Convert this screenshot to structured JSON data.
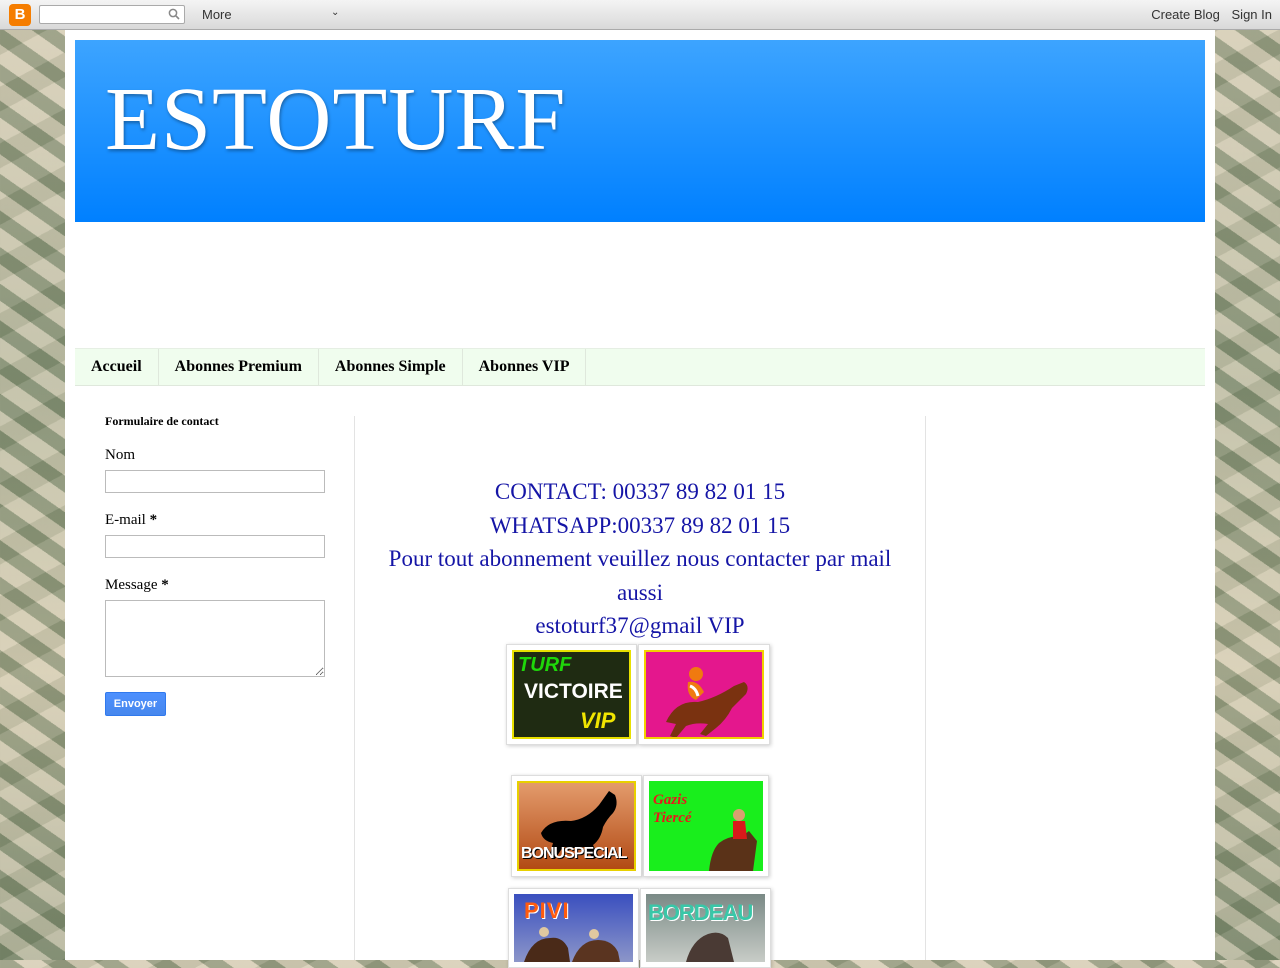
{
  "navbar": {
    "more_label": "More",
    "create_blog_label": "Create Blog",
    "sign_in_label": "Sign In"
  },
  "header": {
    "title": "ESTOTURF"
  },
  "tabs": [
    {
      "label": "Accueil"
    },
    {
      "label": "Abonnes Premium"
    },
    {
      "label": "Abonnes Simple"
    },
    {
      "label": "Abonnes VIP"
    }
  ],
  "contact_form": {
    "title": "Formulaire de contact",
    "name_label": "Nom",
    "email_label": "E-mail",
    "message_label": "Message",
    "required_mark": "*",
    "submit_label": "Envoyer"
  },
  "main": {
    "lines": [
      "CONTACT: 00337 89 82 01 15",
      "WHATSAPP:00337 89 82 01 15",
      "Pour tout abonnement veuillez nous contacter par mail aussi",
      "estoturf37@gmail VIP"
    ],
    "banners": {
      "turf_victoire": {
        "line1": "TURF",
        "line2": "VICTOIRE",
        "line3": "VIP"
      },
      "bonuspecial": {
        "text": "BONUSPECIAL"
      },
      "gazette": {
        "line1": "Gazis",
        "line2": "Tiercé"
      },
      "pivi": {
        "text": "PIVI"
      },
      "bordeau": {
        "text": "BORDEAU"
      }
    }
  },
  "colors": {
    "header_blue": "#0080ff",
    "tab_background": "#f0fdee",
    "contact_text": "#1515a6",
    "button_blue": "#4d90fe"
  },
  "icons": {
    "logo": "blogger-logo-icon",
    "search": "search-icon",
    "dropdown": "chevron-down-icon"
  }
}
